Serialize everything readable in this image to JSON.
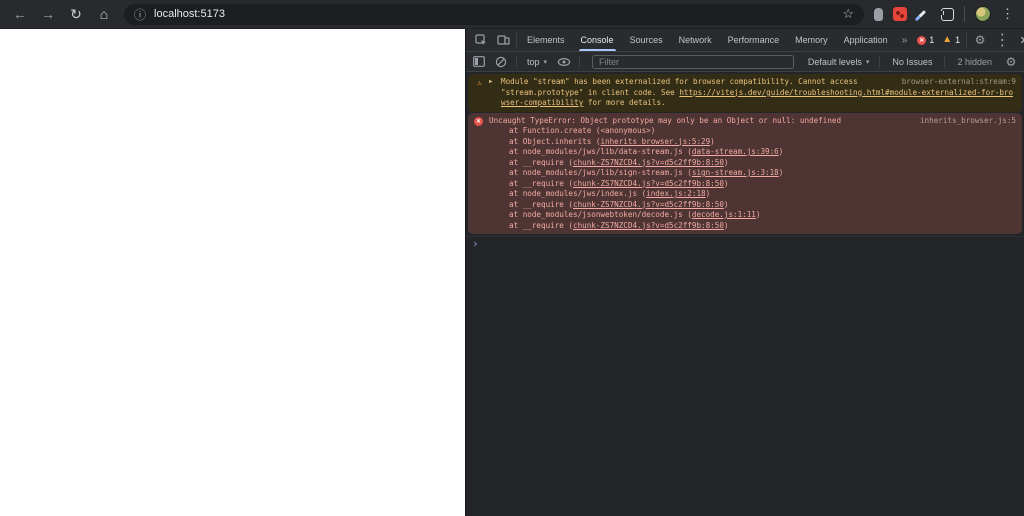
{
  "browser": {
    "url": "localhost:5173",
    "icons": {
      "back": "←",
      "forward": "→",
      "reload": "↻",
      "home": "⌂",
      "info": "ⓘ",
      "star": "☆",
      "menu_kebab": "⋮"
    }
  },
  "devtools": {
    "tabs": [
      {
        "label": "Elements",
        "active": false
      },
      {
        "label": "Console",
        "active": true
      },
      {
        "label": "Sources",
        "active": false
      },
      {
        "label": "Network",
        "active": false
      },
      {
        "label": "Performance",
        "active": false
      },
      {
        "label": "Memory",
        "active": false
      },
      {
        "label": "Application",
        "active": false
      }
    ],
    "more_tabs_glyph": "»",
    "error_count": "1",
    "warning_count": "1",
    "close_glyph": "✕",
    "menu_kebab": "⋮",
    "gear_glyph": "⚙",
    "toolbar": {
      "context_label": "top",
      "caret": "▾",
      "filter_placeholder": "Filter",
      "levels_label": "Default levels",
      "issues_label": "No Issues",
      "hidden_label": "2 hidden",
      "gear_glyph": "⚙"
    },
    "console": {
      "warning": {
        "expand_glyph": "▶",
        "warn_glyph": "⚠",
        "text_before_link": "Module \"stream\" has been externalized for browser compatibility. Cannot access \"stream.prototype\" in client code. See ",
        "link_text": "https://vitejs.dev/guide/troubleshooting.html#module-externalized-for-browser-compatibility",
        "text_after_link": " for more details.",
        "source": "browser-external:stream:9"
      },
      "error": {
        "icon_glyph": "✕",
        "message": "Uncaught TypeError: Object prototype may only be an Object or null: undefined",
        "source": "inherits_browser.js:5",
        "stack": [
          {
            "pre": "at Function.create (<anonymous>)",
            "link": "",
            "post": ""
          },
          {
            "pre": "at Object.inherits (",
            "link": "inherits_browser.js:5:29",
            "post": ")"
          },
          {
            "pre": "at node_modules/jws/lib/data-stream.js (",
            "link": "data-stream.js:39:6",
            "post": ")"
          },
          {
            "pre": "at __require (",
            "link": "chunk-ZS7NZCD4.js?v=d5c2ff9b:8:50",
            "post": ")"
          },
          {
            "pre": "at node_modules/jws/lib/sign-stream.js (",
            "link": "sign-stream.js:3:18",
            "post": ")"
          },
          {
            "pre": "at __require (",
            "link": "chunk-ZS7NZCD4.js?v=d5c2ff9b:8:50",
            "post": ")"
          },
          {
            "pre": "at node_modules/jws/index.js (",
            "link": "index.js:2:18",
            "post": ")"
          },
          {
            "pre": "at __require (",
            "link": "chunk-ZS7NZCD4.js?v=d5c2ff9b:8:50",
            "post": ")"
          },
          {
            "pre": "at node_modules/jsonwebtoken/decode.js (",
            "link": "decode.js:1:11",
            "post": ")"
          },
          {
            "pre": "at __require (",
            "link": "chunk-ZS7NZCD4.js?v=d5c2ff9b:8:50",
            "post": ")"
          }
        ]
      },
      "prompt_glyph": "›"
    },
    "colors": {
      "accent_blue": "#a8c7fa",
      "warning_bg": "#332d16",
      "warning_text": "#e9c17c",
      "error_bg": "#4e3534",
      "error_text": "#f2a9a2",
      "error_badge": "#e5534b",
      "warning_badge": "#efa338"
    }
  }
}
